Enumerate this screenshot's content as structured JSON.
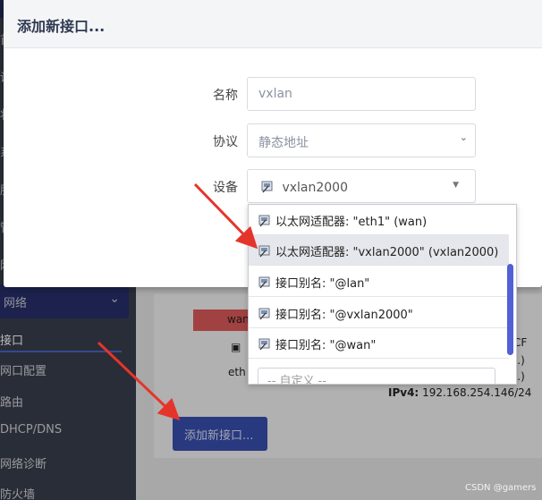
{
  "modal": {
    "title": "添加新接口...",
    "fields": {
      "name": {
        "label": "名称",
        "value": "vxlan"
      },
      "protocol": {
        "label": "协议",
        "value": "静态地址"
      },
      "device": {
        "label": "设备",
        "value": "vxlan2000"
      }
    }
  },
  "dropdown": {
    "items": [
      "以太网适配器: \"eth1\" (wan)",
      "以太网适配器: \"vxlan2000\" (vxlan2000)",
      "接口别名: \"@lan\"",
      "接口别名: \"@vxlan2000\"",
      "接口别名: \"@wan\""
    ],
    "highlighted_index": 1,
    "custom_placeholder": "-- 自定义 --"
  },
  "background": {
    "sidebar": {
      "section": "网络",
      "items": [
        "接口",
        "网口配置",
        "路由",
        "DHCP/DNS",
        "网络诊断",
        "防火墙"
      ],
      "partial_letters": [
        "首",
        "设",
        "状",
        "系",
        "服",
        "管",
        "网"
      ]
    },
    "interface_card": {
      "tag": "wan",
      "device_short": "eth",
      "right_fragments": [
        "CF",
        "s.)",
        "s.)"
      ],
      "ipv4_label": "IPv4:",
      "ipv4_value": "192.168.254.146/24"
    },
    "add_button": "添加新接口..."
  },
  "watermark": "CSDN @gamers",
  "colors": {
    "accent": "#3a4fb0",
    "nav_active": "#27306b",
    "arrow": "#e5352b",
    "tag_red": "#e15a5a",
    "scrollbar": "#5160d6"
  }
}
